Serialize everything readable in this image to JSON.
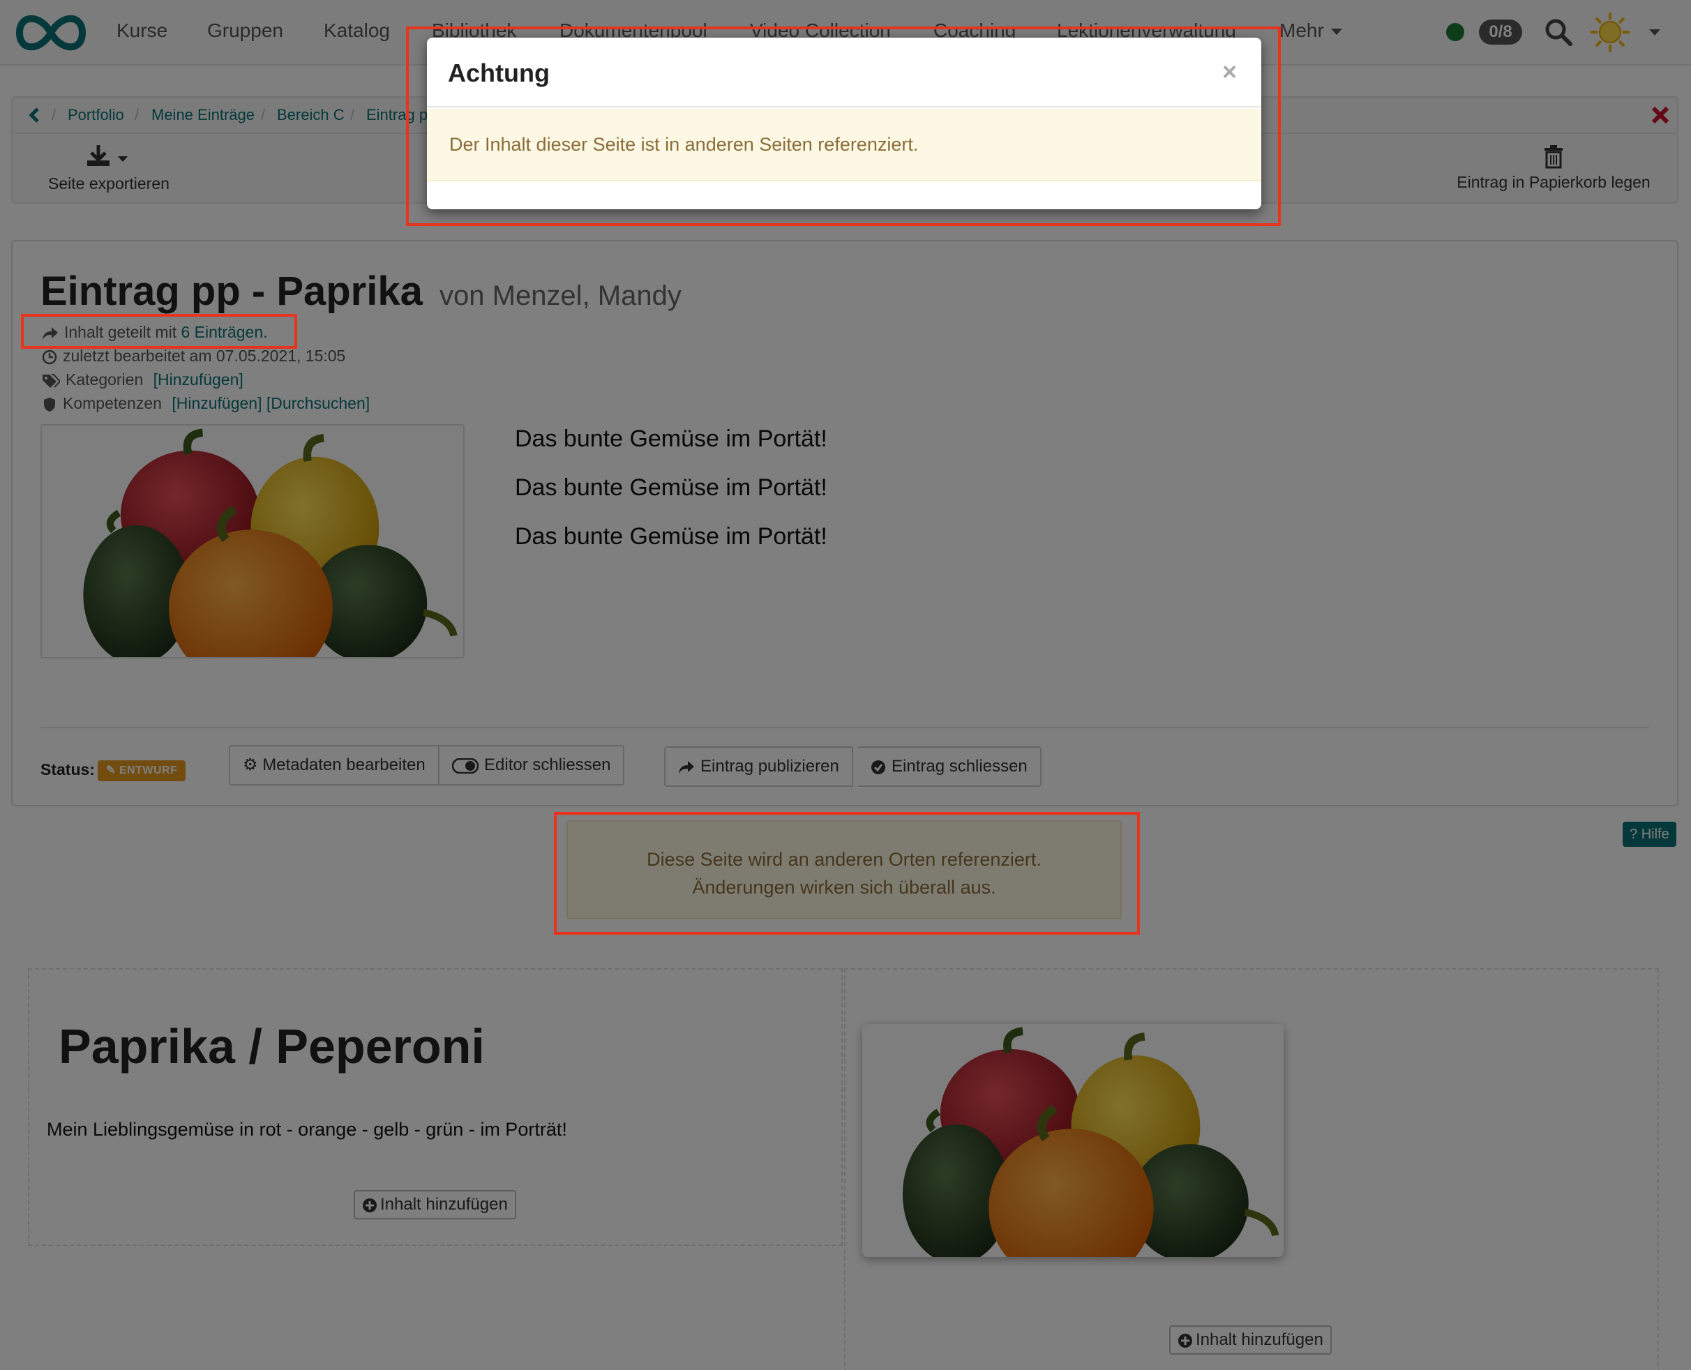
{
  "nav": {
    "items": [
      "Kurse",
      "Gruppen",
      "Katalog",
      "Bibliothek",
      "Dokumentenpool",
      "Video Collection",
      "Coaching",
      "Lektionenverwaltung"
    ],
    "more": "Mehr",
    "badge": "0/8",
    "colors": {
      "status_dot": "#1a7a30",
      "logo": "#0b7075"
    }
  },
  "breadcrumb": {
    "items": [
      "Portfolio",
      "Meine Einträge",
      "Bereich C",
      "Eintrag p"
    ]
  },
  "toolbar": {
    "export_label": "Seite exportieren",
    "trash_label": "Eintrag in Papierkorb legen"
  },
  "entry": {
    "title": "Eintrag pp - Paprika",
    "author": "von Menzel, Mandy",
    "shared_prefix": "Inhalt geteilt mit",
    "shared_link": "6 Einträgen.",
    "edited": "zuletzt bearbeitet am 07.05.2021, 15:05",
    "categories_label": "Kategorien",
    "categories_add": "[Hinzufügen]",
    "competences_label": "Kompetenzen",
    "competences_add": "[Hinzufügen]",
    "competences_search": "[Durchsuchen]",
    "teaser_lines": [
      "Das bunte Gemüse im Portät!",
      "Das bunte Gemüse im Portät!",
      "Das bunte Gemüse im Portät!"
    ],
    "status_label": "Status:",
    "status_badge": "ENTWURF",
    "buttons": {
      "metadata": "Metadaten bearbeiten",
      "editor": "Editor schliessen",
      "publish": "Eintrag publizieren",
      "close": "Eintrag schliessen"
    }
  },
  "warning": {
    "line1": "Diese Seite wird an anderen Orten referenziert.",
    "line2": "Änderungen wirken sich überall aus."
  },
  "help_label": "Hilfe",
  "page": {
    "heading": "Paprika / Peperoni",
    "text": "Mein Lieblingsgemüse in rot - orange - gelb - grün - im Porträt!",
    "add_content": "Inhalt hinzufügen"
  },
  "modal": {
    "title": "Achtung",
    "close": "×",
    "message": "Der Inhalt dieser Seite ist in anderen Seiten referenziert."
  },
  "colors": {
    "accent": "#0b7075",
    "warning_bg": "#fcf8e3",
    "warning_text": "#8a6d3b",
    "status_badge": "#e69b1e",
    "highlight": "#e8331f"
  }
}
